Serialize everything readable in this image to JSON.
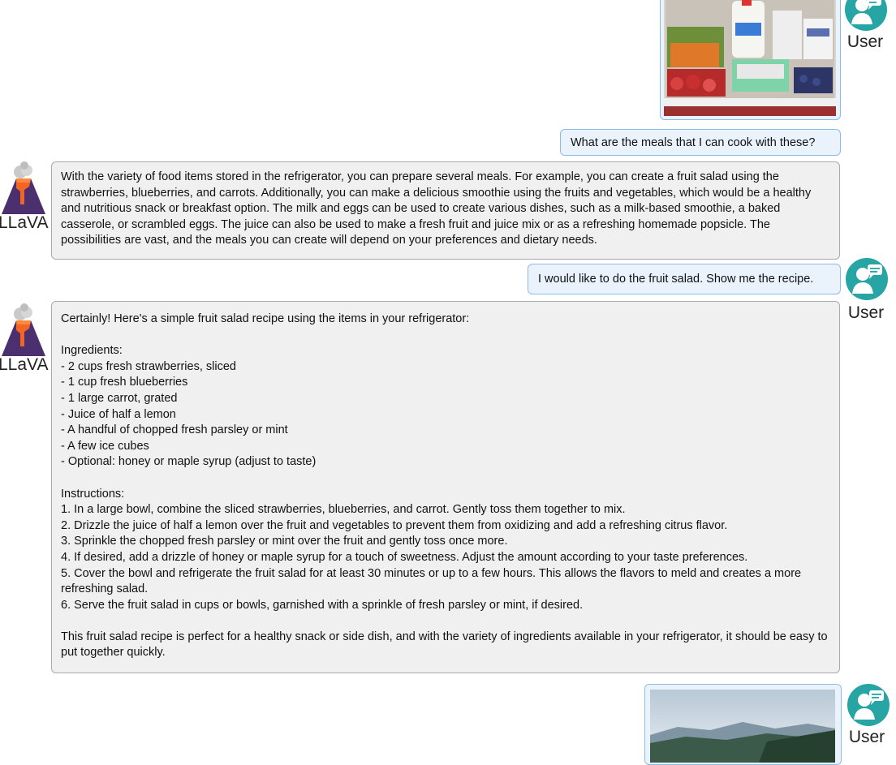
{
  "labels": {
    "user": "User",
    "bot": "LLaVA"
  },
  "icons": {
    "user_avatar": "user-chat-icon",
    "bot_avatar": "volcano-llava-icon"
  },
  "colors": {
    "user_avatar_bg": "#27a5a5",
    "user_bubble_bg": "#eaf3fc",
    "user_bubble_border": "#8bbce8",
    "bot_bubble_bg": "#f0f0f0",
    "bot_bubble_border": "#a9a9a9"
  },
  "messages": {
    "user_1": "What are the meals that I can cook with these?",
    "bot_1": "With the variety of food items stored in the refrigerator, you can prepare several meals. For example, you can create a fruit salad using the strawberries, blueberries, and carrots. Additionally, you can make a delicious smoothie using the fruits and vegetables, which would be a healthy and nutritious snack or breakfast option. The milk and eggs can be used to create various dishes, such as a milk-based smoothie, a baked casserole, or scrambled eggs. The juice can also be used to make a fresh fruit and juice mix or as a refreshing homemade popsicle. The possibilities are vast, and the meals you can create will depend on your preferences and dietary needs.",
    "user_2": "I would like to do the fruit salad.  Show me the recipe.",
    "bot_2": {
      "intro": "Certainly! Here's a simple fruit salad recipe using the items in your refrigerator:",
      "ingredients_heading": "Ingredients:",
      "ingredients": [
        "- 2 cups fresh strawberries, sliced",
        "- 1 cup fresh blueberries",
        "- 1 large carrot, grated",
        "- Juice of half a lemon",
        "- A handful of chopped fresh parsley or mint",
        "- A few ice cubes",
        "- Optional: honey or maple syrup (adjust to taste)"
      ],
      "instructions_heading": "Instructions:",
      "instructions": [
        "1. In a large bowl, combine the sliced strawberries, blueberries, and carrot. Gently toss them together to mix.",
        "2. Drizzle the juice of half a lemon over the fruit and vegetables to prevent them from oxidizing and add a refreshing citrus flavor.",
        "3. Sprinkle the chopped fresh parsley or mint over the fruit and gently toss once more.",
        "4. If desired, add a drizzle of honey or maple syrup for a touch of sweetness. Adjust the amount according to your taste preferences.",
        "5. Cover the bowl and refrigerate the fruit salad for at least 30 minutes or up to a few hours. This allows the flavors to meld and creates a more refreshing salad.",
        "6. Serve the fruit salad in cups or bowls, garnished with a sprinkle of fresh parsley or mint, if desired."
      ],
      "closing": "This fruit salad recipe is perfect for a healthy snack or side dish, and with the variety of ingredients available in your refrigerator, it should be easy to put together quickly."
    }
  }
}
